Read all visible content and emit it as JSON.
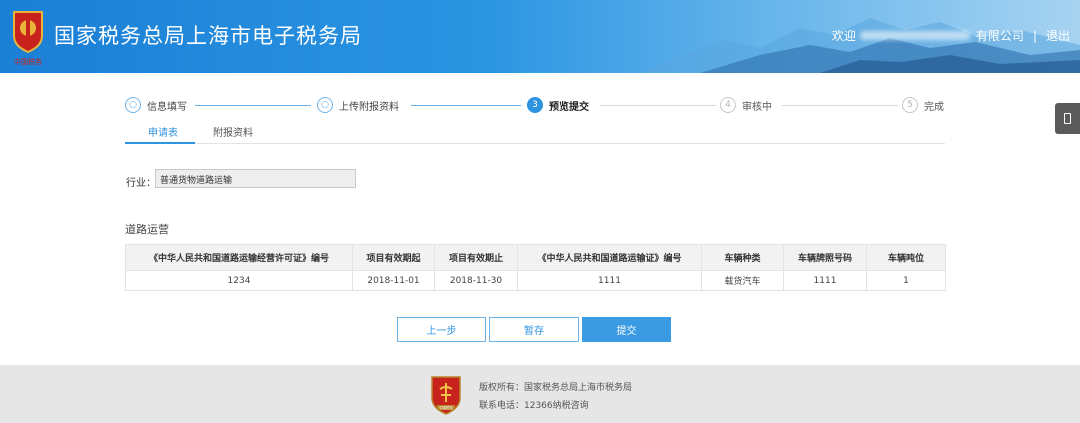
{
  "header": {
    "title": "国家税务总局上海市电子税务局",
    "logo_text": "中国税务",
    "welcome": "欢迎",
    "company_suffix": "有限公司",
    "separator": "|",
    "logout": "退出",
    "colors": {
      "bar": "#2b95e2",
      "bar_light": "#a7d3f1"
    }
  },
  "steps": [
    {
      "num": "○",
      "label": "信息填写",
      "state": "done"
    },
    {
      "num": "○",
      "label": "上传附报资料",
      "state": "done"
    },
    {
      "num": "3",
      "label": "预览提交",
      "state": "active"
    },
    {
      "num": "4",
      "label": "审核中",
      "state": "todo"
    },
    {
      "num": "5",
      "label": "完成",
      "state": "todo"
    }
  ],
  "tabs": [
    {
      "label": "申请表",
      "active": true
    },
    {
      "label": "附报资料",
      "active": false
    }
  ],
  "form": {
    "industry_label": "行业：",
    "industry_value": "普通货物道路运输"
  },
  "section": {
    "title": "道路运营"
  },
  "table": {
    "headers": [
      "《中华人民共和国道路运输经营许可证》编号",
      "项目有效期起",
      "项目有效期止",
      "《中华人民共和国道路运输证》编号",
      "车辆种类",
      "车辆牌照号码",
      "车辆吨位"
    ],
    "rows": [
      [
        "1234",
        "2018-11-01",
        "2018-11-30",
        "1111",
        "载货汽车",
        "1111",
        "1"
      ]
    ]
  },
  "buttons": {
    "prev": "上一步",
    "save": "暂存",
    "submit": "提交"
  },
  "footer": {
    "copyright": "版权所有：国家税务总局上海市税务局",
    "contact": "联系电话：12366纳税咨询",
    "logo_text": "中国税务"
  },
  "colors": {
    "accent": "#2f94e0",
    "footer_bg": "#e6e6e6"
  }
}
